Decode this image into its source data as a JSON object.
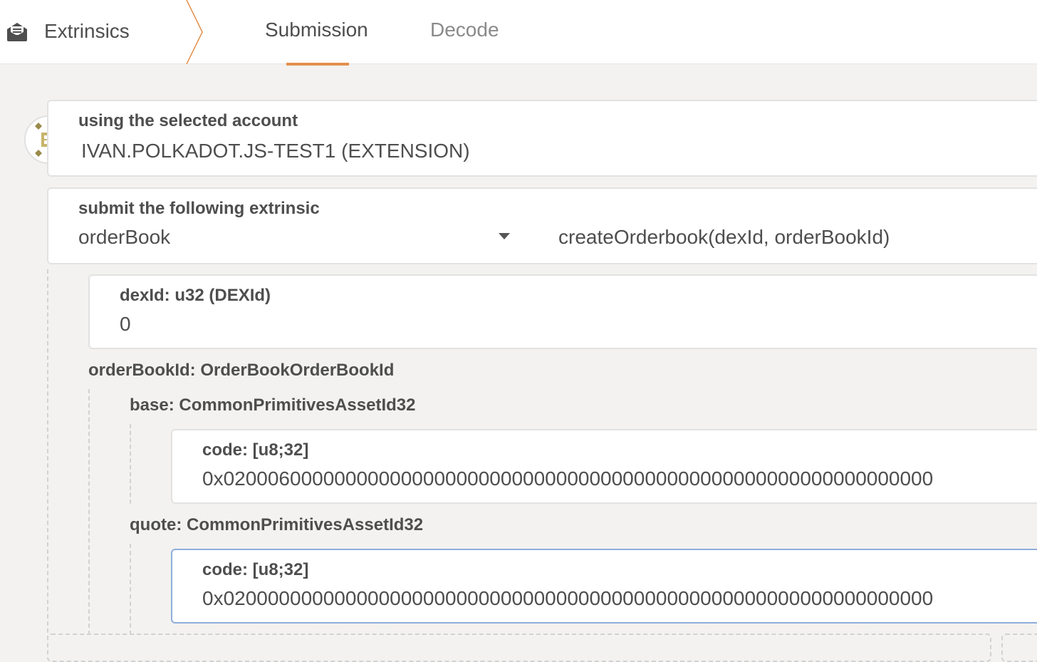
{
  "header": {
    "section_title": "Extrinsics",
    "section_icon": "envelope-open-icon",
    "tabs": [
      {
        "label": "Submission",
        "active": true
      },
      {
        "label": "Decode",
        "active": false
      }
    ],
    "accent_color": "#e4904c"
  },
  "account": {
    "label": "using the selected account",
    "value": "IVAN.POLKADOT.JS-TEST1 (EXTENSION)"
  },
  "extrinsic": {
    "label": "submit the following extrinsic",
    "section": "orderBook",
    "method": "createOrderbook(dexId, orderBookId)"
  },
  "params": {
    "dexId": {
      "label": "dexId: u32 (DEXId)",
      "value": "0"
    },
    "orderBookId": {
      "label": "orderBookId: OrderBookOrderBookId",
      "base": {
        "label": "base: CommonPrimitivesAssetId32",
        "code_label": "code: [u8;32]",
        "code_value": "0x0200060000000000000000000000000000000000000000000000000000000000"
      },
      "quote": {
        "label": "quote: CommonPrimitivesAssetId32",
        "code_label": "code: [u8;32]",
        "code_value": "0x0200000000000000000000000000000000000000000000000000000000000000"
      }
    }
  }
}
